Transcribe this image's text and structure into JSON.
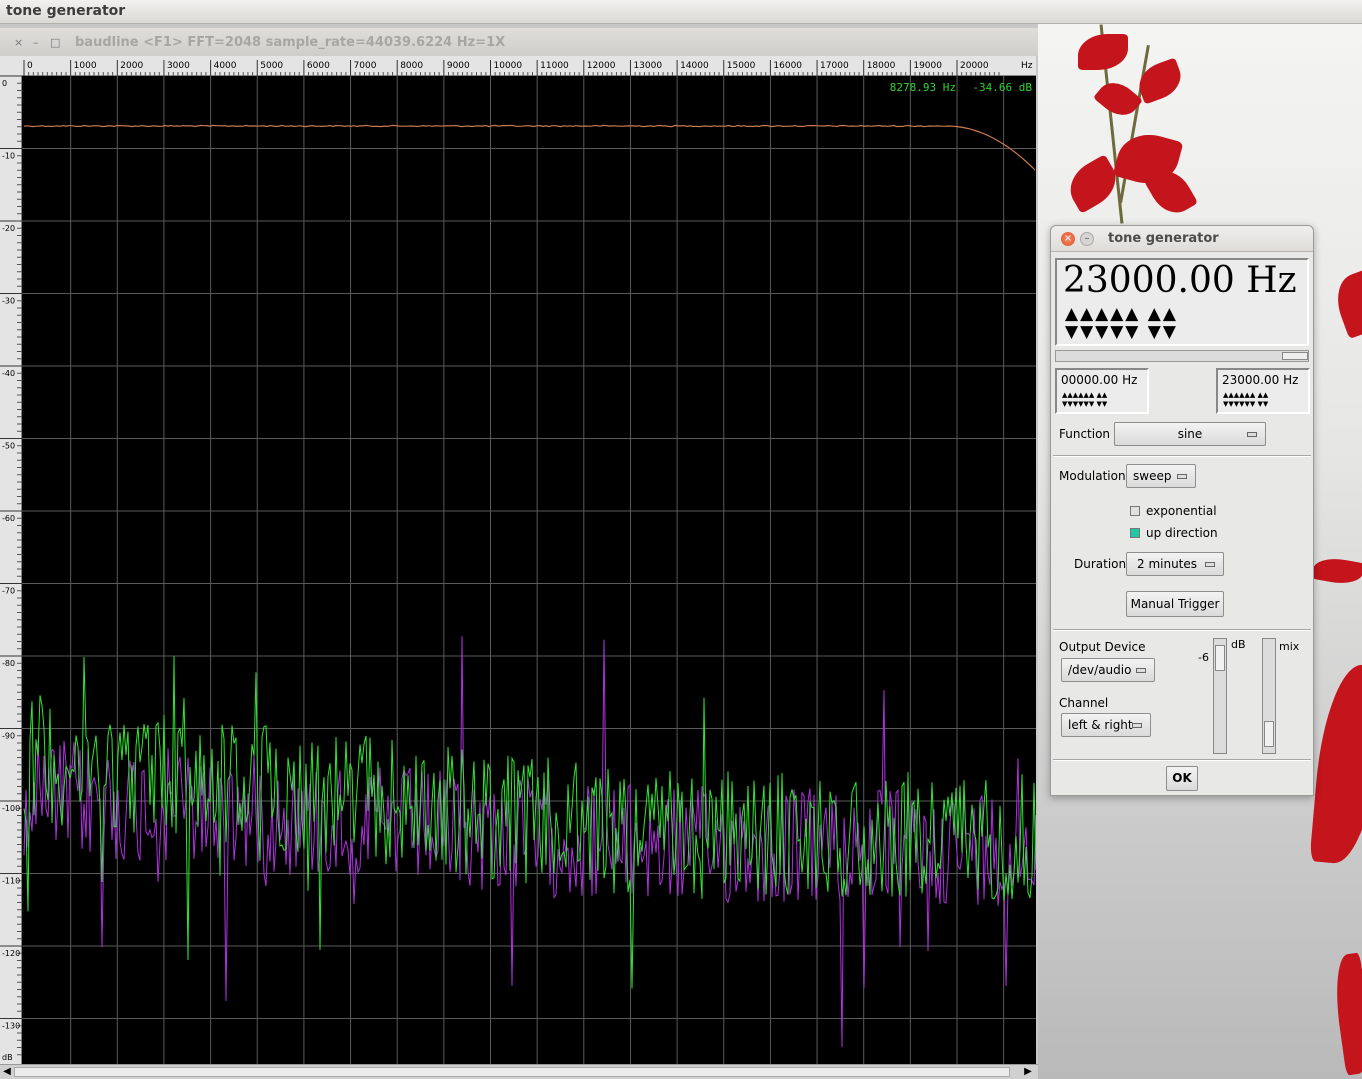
{
  "top_window_title": "tone generator",
  "baudline": {
    "title": "baudline  <F1> FFT=2048 sample_rate=44039.6224 Hz=1X",
    "close_glyph": "×",
    "min_glyph": "–",
    "max_glyph": "□",
    "x_ticks": [
      "0",
      "1000",
      "2000",
      "3000",
      "4000",
      "5000",
      "6000",
      "7000",
      "8000",
      "9000",
      "10000",
      "11000",
      "12000",
      "13000",
      "14000",
      "15000",
      "16000",
      "17000",
      "18000",
      "19000",
      "20000",
      "Hz"
    ],
    "y_ticks": [
      "0",
      "-10",
      "-20",
      "-30",
      "-40",
      "-50",
      "-60",
      "-70",
      "-80",
      "-90",
      "-100",
      "-110",
      "-120",
      "-130",
      "dB"
    ],
    "readout_hz": "8278.93 Hz",
    "readout_db": "-34.66 dB",
    "scroll_left_glyph": "◀",
    "scroll_right_glyph": "▶",
    "colors": {
      "plot_background": "#000000",
      "grid": "#5a5a5a",
      "trace_top": "#c87a50",
      "trace_green": "#2ee62e",
      "trace_purple": "#b030e0",
      "readout": "#2fd42f"
    }
  },
  "tone_generator": {
    "title": "tone generator",
    "close_glyph": "×",
    "min_glyph": "–",
    "frequency": "23000.00 Hz",
    "up_arrows": "▲▲▲▲▲ ▲▲",
    "down_arrows": "▼▼▼▼▼ ▼▼",
    "start_frequency": "00000.00 Hz",
    "end_frequency": "23000.00 Hz",
    "mini_up_arrows": "▲▲▲▲▲▲ ▲▲",
    "mini_down_arrows": "▼▼▼▼▼▼ ▼▼",
    "function_label": "Function",
    "function_value": "sine",
    "modulation_label": "Modulation",
    "modulation_value": "sweep",
    "exponential_label": "exponential",
    "exponential_checked": false,
    "up_direction_label": "up direction",
    "up_direction_checked": true,
    "duration_label": "Duration",
    "duration_value": "2 minutes",
    "manual_trigger_label": "Manual Trigger",
    "output_device_label": "Output Device",
    "output_device_value": "/dev/audio",
    "channel_label": "Channel",
    "channel_value": "left & right",
    "db_label": "dB",
    "db_value": "-6",
    "mix_label": "mix",
    "ok_label": "OK"
  }
}
